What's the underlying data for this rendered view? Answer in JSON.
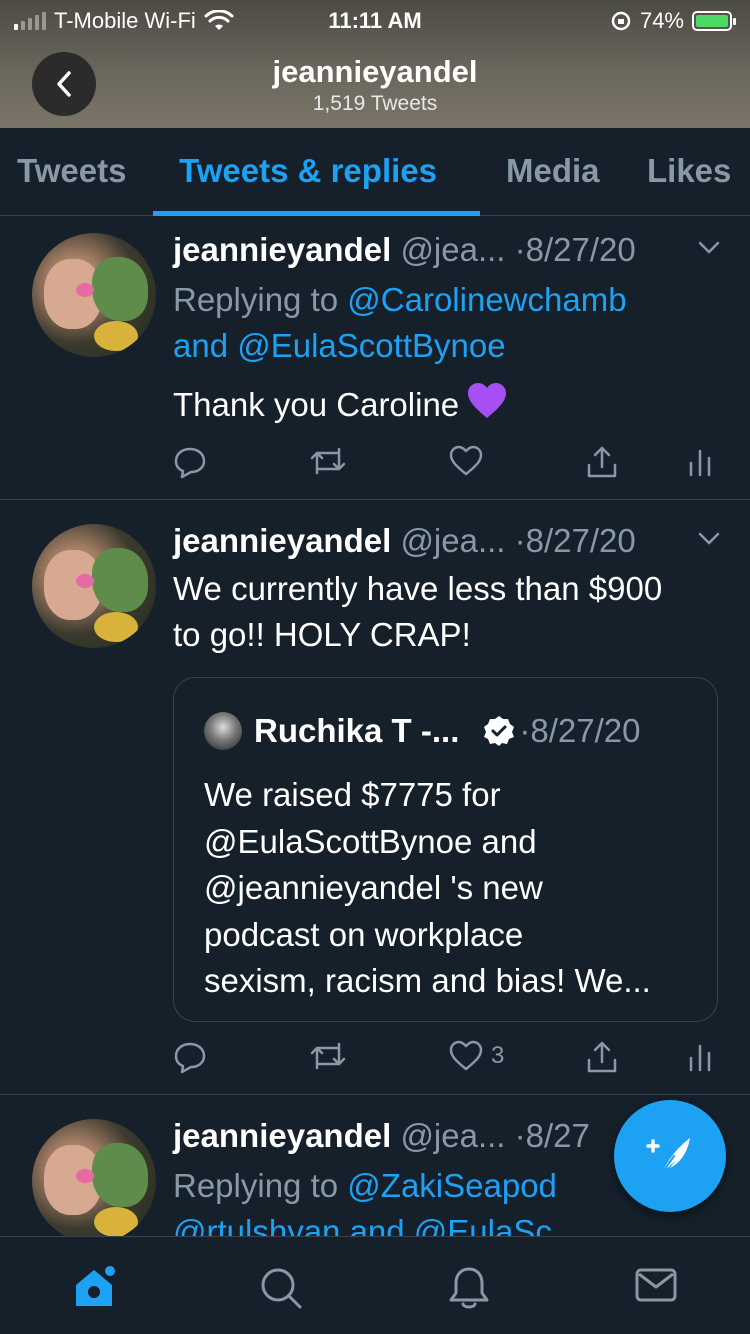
{
  "status_bar": {
    "carrier": "T-Mobile Wi-Fi",
    "time": "11:11 AM",
    "battery": "74%"
  },
  "header": {
    "title": "jeannieyandel",
    "subtitle": "1,519 Tweets"
  },
  "tabs": [
    {
      "label": "Tweets",
      "active": false
    },
    {
      "label": "Tweets & replies",
      "active": true
    },
    {
      "label": "Media",
      "active": false
    },
    {
      "label": "Likes",
      "active": false
    }
  ],
  "tweets": [
    {
      "name": "jeannieyandel",
      "handle": "@jea...",
      "date": "·8/27/20",
      "replying_prefix": "Replying to",
      "replying_line1_link": "@Carolinewchamb",
      "replying_line2_and": "and",
      "replying_line2_link": "@EulaScottBynoe",
      "text": "Thank you Caroline"
    },
    {
      "name": "jeannieyandel",
      "handle": "@jea...",
      "date": "·8/27/20",
      "text_line1": "We currently have less than $900",
      "text_line2": "to go!! HOLY CRAP!",
      "quote": {
        "name": "Ruchika T -...",
        "date": "·8/27/20",
        "lines": [
          "We raised $7775 for",
          "@EulaScottBynoe and",
          "@jeannieyandel 's new",
          "podcast on workplace",
          "sexism, racism and bias! We..."
        ]
      },
      "like_count": "3"
    },
    {
      "name": "jeannieyandel",
      "handle": "@jea...",
      "date": "·8/27",
      "replying_prefix": "Replying to",
      "replying_line1_link": "@ZakiSeapod",
      "replying_line2_partial": "@rtulshyan and @EulaSc"
    }
  ],
  "colors": {
    "background": "#15202b",
    "accent": "#1da1f2",
    "muted": "#8899a6",
    "border": "#38444d"
  },
  "icons": [
    "back-arrow-icon",
    "reply-icon",
    "retweet-icon",
    "like-icon",
    "share-icon",
    "analytics-icon",
    "verified-icon",
    "compose-icon",
    "home-icon",
    "search-icon",
    "notifications-icon",
    "messages-icon"
  ]
}
